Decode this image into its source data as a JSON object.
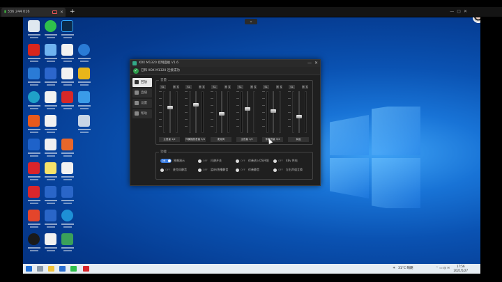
{
  "session": {
    "tab_id": "336 244 016",
    "new_tab": "+",
    "toggle": "⌄"
  },
  "app": {
    "title": "XOX M1320 控制面板 V1.6",
    "connected": "已和 XOX M1320 连接成功",
    "sidebar": [
      "回放",
      "直播",
      "设置",
      "帮助"
    ],
    "mixer_label": "音量",
    "features_label": "功能"
  },
  "mixer": {
    "channels": [
      {
        "name": "主音量 1/2",
        "level": 0.62
      },
      {
        "name": "伴奏播放音量 3/4",
        "level": 0.7
      },
      {
        "name": "麦克风",
        "level": 0.45
      },
      {
        "name": "主音量 1/2",
        "level": 0.58
      },
      {
        "name": "伴奏音量 3/4",
        "level": 0.52
      },
      {
        "name": "耳返",
        "level": 0.38
      }
    ]
  },
  "features": [
    {
      "state": "ON",
      "label": "独唱演示",
      "on": true
    },
    {
      "state": "OFF",
      "label": "闪避开关",
      "on": false
    },
    {
      "state": "OFF",
      "label": "伴奏进入OS环境",
      "on": false
    },
    {
      "state": "OFF",
      "label": "48v 供电",
      "on": false
    },
    {
      "state": "OFF",
      "label": "麦克风静音",
      "on": false
    },
    {
      "state": "OFF",
      "label": "监听/直播静音",
      "on": false
    },
    {
      "state": "OFF",
      "label": "伴奏静音",
      "on": false
    },
    {
      "state": "OFF",
      "label": "左右声道互换",
      "on": false
    }
  ],
  "taskbar": {
    "weather": "31°C 晴朗",
    "time": "17:56",
    "date": "2021/5/27"
  }
}
